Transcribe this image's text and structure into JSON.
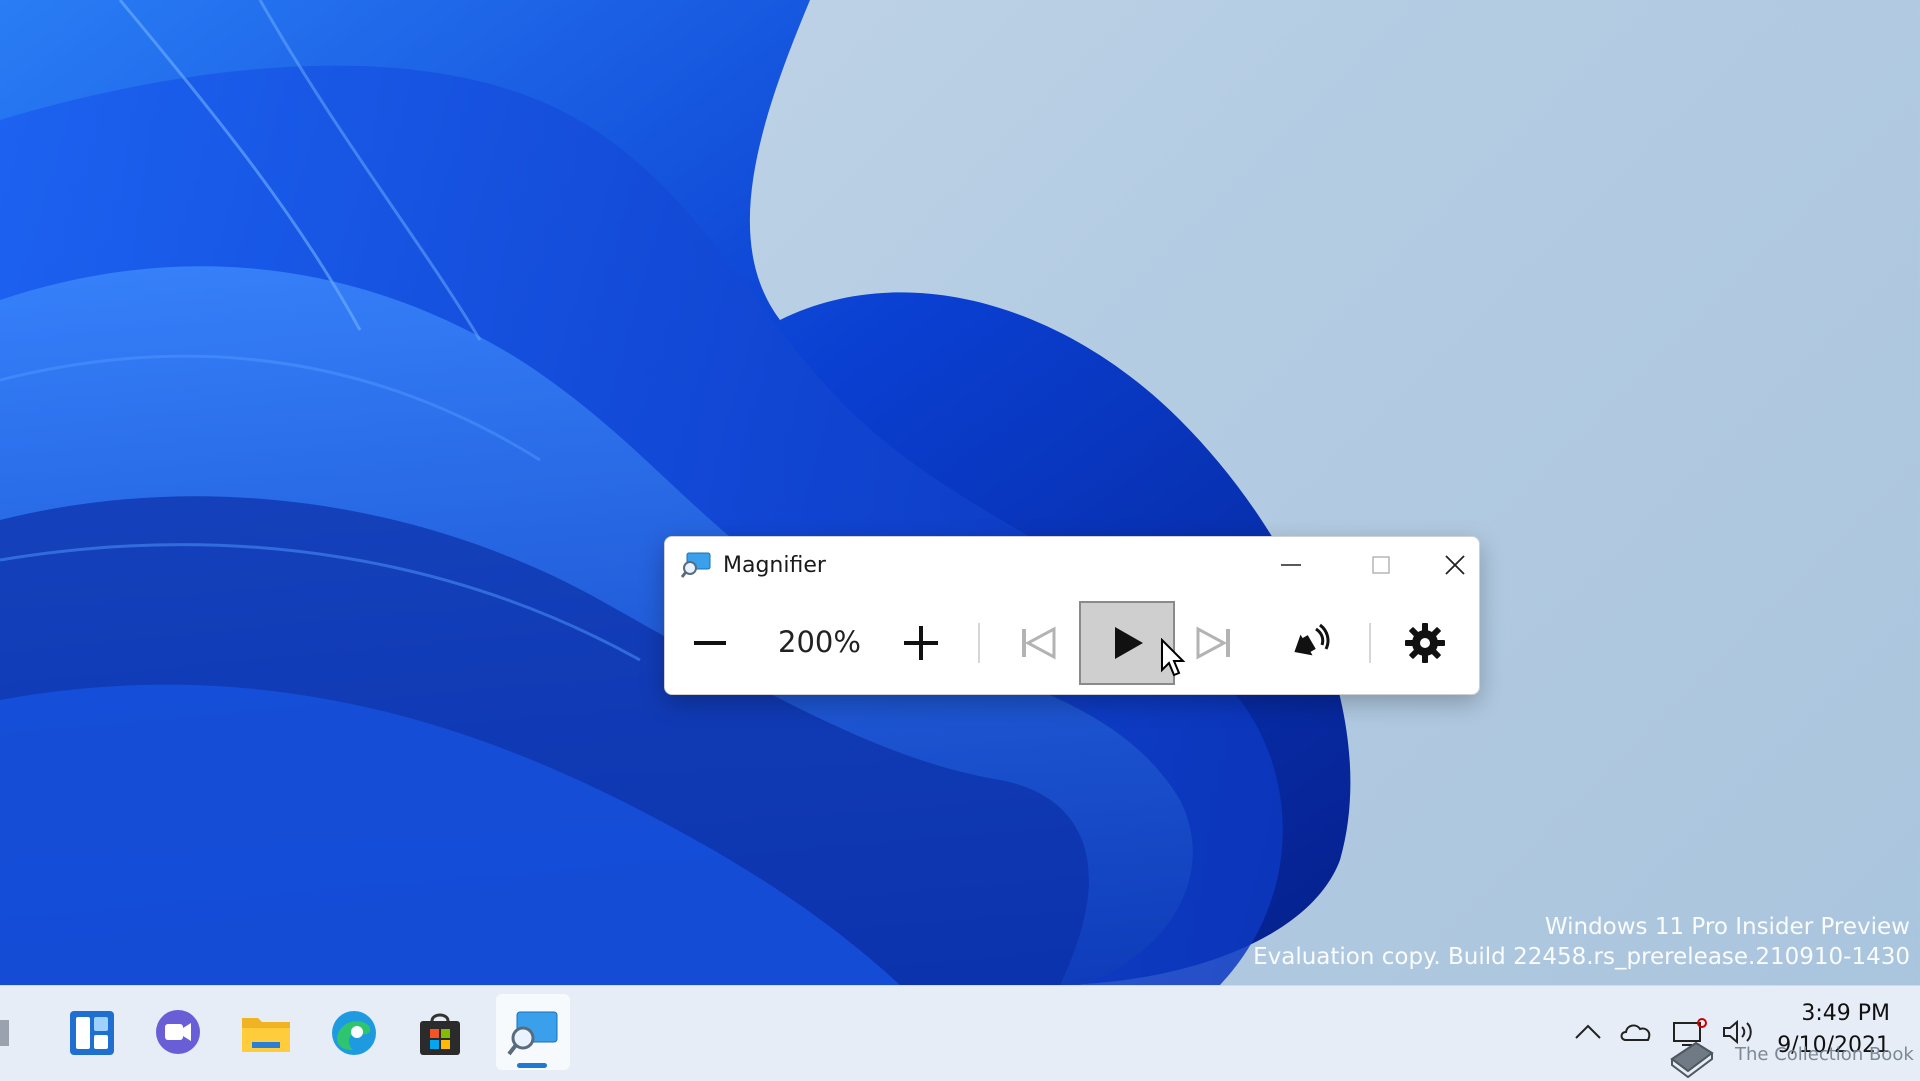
{
  "window": {
    "title": "Magnifier",
    "zoom_level": "200%",
    "controls": {
      "zoom_out": "zoom-out",
      "zoom_in": "zoom-in",
      "previous": "previous",
      "play": "play",
      "next": "next",
      "read_aloud": "read-aloud",
      "settings": "settings"
    }
  },
  "watermark": {
    "line1": "Windows 11 Pro Insider Preview",
    "line2": "Evaluation copy. Build 22458.rs_prerelease.210910-1430"
  },
  "taskbar": {
    "apps": [
      "widgets",
      "teams-chat",
      "file-explorer",
      "edge",
      "store",
      "magnifier"
    ],
    "active_app": "magnifier"
  },
  "tray": {
    "clock_time": "3:49 PM",
    "clock_date": "9/10/2021",
    "overlay_text": "The Collection Book"
  },
  "colors": {
    "accent": "#1f78d1",
    "wallpaper_blue": "#0a3fd1"
  }
}
